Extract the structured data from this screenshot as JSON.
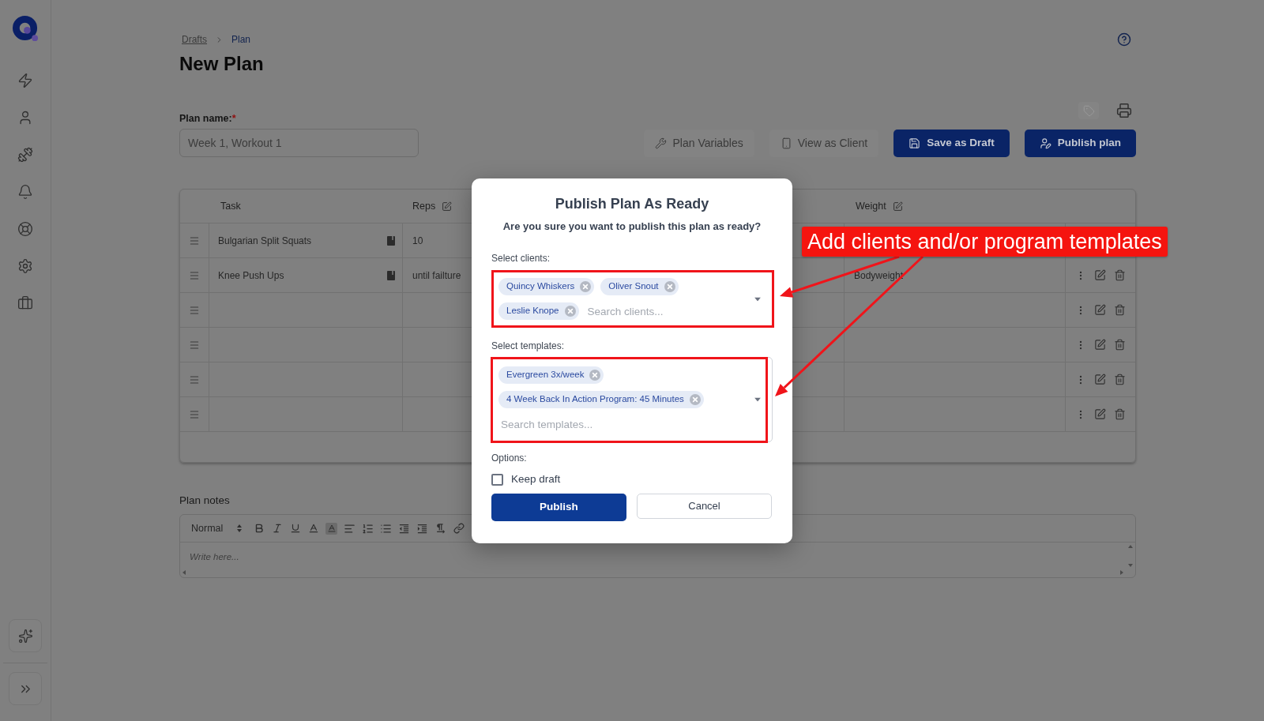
{
  "breadcrumb": [
    {
      "label": "Drafts",
      "kind": "link"
    },
    {
      "label": "Plan",
      "kind": "current"
    }
  ],
  "page_title": "New Plan",
  "plan_name": {
    "label": "Plan name:",
    "required_mark": "*",
    "value": "Week 1, Workout 1"
  },
  "toolbar_buttons": [
    {
      "label": "Plan Variables",
      "kind": "secondary"
    },
    {
      "label": "View as Client",
      "kind": "secondary"
    },
    {
      "label": "Save as Draft",
      "kind": "primary"
    },
    {
      "label": "Publish plan",
      "kind": "primary"
    }
  ],
  "table": {
    "columns": [
      {
        "label": "Task",
        "editable": false
      },
      {
        "label": "Reps",
        "editable": true
      },
      {
        "label": "Weight",
        "editable": true
      }
    ],
    "rows": [
      {
        "task": "Bulgarian Split Squats",
        "reps": "10"
      },
      {
        "task": "Knee Push Ups",
        "reps": "until failture",
        "weight": "Bodyweight",
        "row_actions": true
      },
      {
        "row_actions": true
      },
      {
        "row_actions": true
      },
      {
        "row_actions": true
      },
      {
        "row_actions": true
      }
    ]
  },
  "plan_notes": {
    "label": "Plan notes",
    "format": "Normal",
    "placeholder": "Write here..."
  },
  "dialog": {
    "title": "Publish Plan As Ready",
    "subtitle": "Are you sure you want to publish this plan as ready?",
    "clients": {
      "label": "Select clients:",
      "chips": [
        "Quincy Whiskers",
        "Oliver Snout",
        "Leslie Knope"
      ],
      "placeholder": "Search clients..."
    },
    "templates": {
      "label": "Select templates:",
      "chips": [
        "Evergreen 3x/week",
        "4 Week Back In Action Program: 45 Minutes"
      ],
      "placeholder": "Search templates..."
    },
    "options_label": "Options:",
    "options": [
      {
        "label": "Keep draft",
        "checked": false
      }
    ],
    "buttons": [
      {
        "label": "Publish",
        "kind": "primary"
      },
      {
        "label": "Cancel",
        "kind": "secondary"
      }
    ]
  },
  "annotation": {
    "label": "Add clients and/or program templates"
  }
}
